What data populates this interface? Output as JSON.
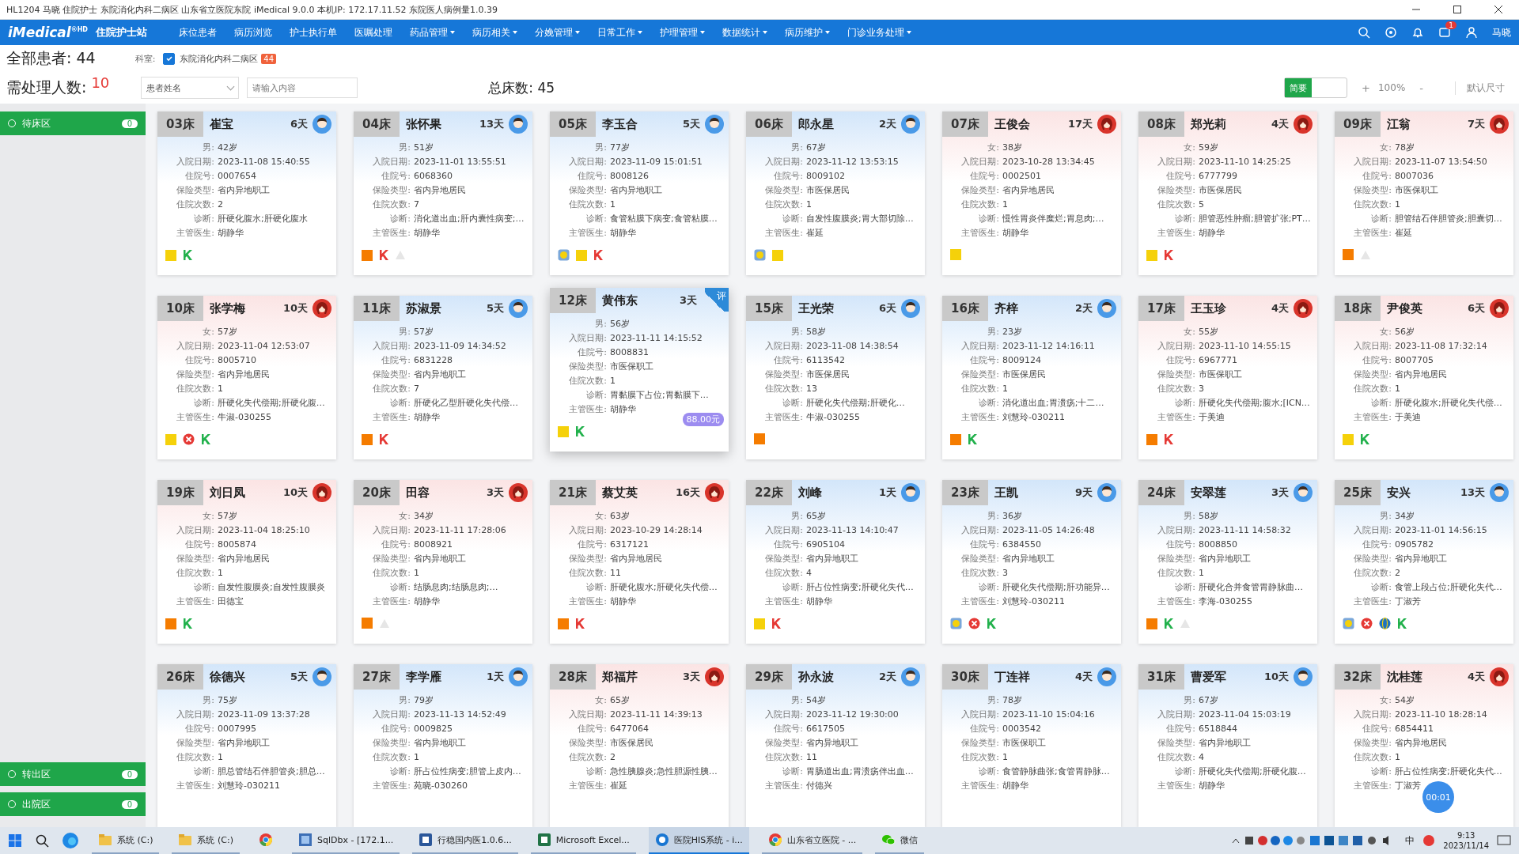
{
  "window": {
    "title": "HL1204 马晓 住院护士 东院消化内科二病区 山东省立医院东院 iMedical 9.0.0 本机IP: 172.17.11.52 东院医人病例量1.0.39"
  },
  "nav": {
    "logo": "iMedical",
    "logo_sup": "®HD",
    "module": "住院护士站",
    "items": [
      {
        "label": "床位患者",
        "dropdown": false
      },
      {
        "label": "病历浏览",
        "dropdown": false
      },
      {
        "label": "护士执行单",
        "dropdown": false
      },
      {
        "label": "医嘱处理",
        "dropdown": false
      },
      {
        "label": "药品管理",
        "dropdown": true
      },
      {
        "label": "病历相关",
        "dropdown": true
      },
      {
        "label": "分娩管理",
        "dropdown": true
      },
      {
        "label": "日常工作",
        "dropdown": true
      },
      {
        "label": "护理管理",
        "dropdown": true
      },
      {
        "label": "数据统计",
        "dropdown": true
      },
      {
        "label": "病历维护",
        "dropdown": true
      },
      {
        "label": "门诊业务处理",
        "dropdown": true
      }
    ],
    "message_badge": "1",
    "user": "马晓"
  },
  "summary": {
    "all_label": "全部患者: 44",
    "dept_label": "科室:",
    "dept_checked": true,
    "dept_name": "东院消化内科二病区",
    "dept_count": "44",
    "pending_label": "需处理人数:",
    "pending_count": "10",
    "name_select": "患者姓名",
    "search_placeholder": "请输入内容",
    "total_beds": "总床数: 45",
    "brief_label": "简要",
    "brief_on": true,
    "zoom_plus": "+",
    "zoom": "100%",
    "zoom_minus": "-",
    "default_size": "默认尺寸"
  },
  "sidebar": {
    "top": [
      {
        "label": "待床区",
        "count": "0"
      }
    ],
    "bottom": [
      {
        "label": "转出区",
        "count": "0"
      },
      {
        "label": "出院区",
        "count": "0"
      }
    ]
  },
  "cards": [
    {
      "bed": "03床",
      "name": "崔宝",
      "days": "6天",
      "kind": "male",
      "fields": [
        [
          "男:",
          "42岁"
        ],
        [
          "入院日期:",
          "2023-11-08 15:40:55"
        ],
        [
          "住院号:",
          "0007654"
        ],
        [
          "保险类型:",
          "省内异地职工"
        ],
        [
          "住院次数:",
          "2"
        ],
        [
          "诊断:",
          "肝硬化腹水;肝硬化腹水"
        ],
        [
          "主管医生:",
          "胡静华"
        ]
      ],
      "icons": [
        {
          "kind": "square",
          "color": "#f5d10a"
        },
        {
          "kind": "flag",
          "color": "#22b14c"
        }
      ]
    },
    {
      "bed": "04床",
      "name": "张怀果",
      "days": "13天",
      "kind": "male",
      "fields": [
        [
          "男:",
          "51岁"
        ],
        [
          "入院日期:",
          "2023-11-01 13:55:51"
        ],
        [
          "住院号:",
          "6068360"
        ],
        [
          "保险类型:",
          "省内异地居民"
        ],
        [
          "住院次数:",
          "7"
        ],
        [
          "诊断:",
          "消化道出血;肝内囊性病变;…"
        ],
        [
          "主管医生:",
          "胡静华"
        ]
      ],
      "icons": [
        {
          "kind": "square",
          "color": "#f57c00"
        },
        {
          "kind": "flag",
          "color": "#e53935"
        },
        {
          "kind": "triangle",
          "color": "#e6e6e6"
        }
      ]
    },
    {
      "bed": "05床",
      "name": "李玉合",
      "days": "5天",
      "kind": "male",
      "fields": [
        [
          "男:",
          "77岁"
        ],
        [
          "入院日期:",
          "2023-11-09 15:01:51"
        ],
        [
          "住院号:",
          "8008126"
        ],
        [
          "保险类型:",
          "省内异地职工"
        ],
        [
          "住院次数:",
          "1"
        ],
        [
          "诊断:",
          "食管粘膜下病变;食管粘膜…"
        ],
        [
          "主管医生:",
          "胡静华"
        ]
      ],
      "icons": [
        {
          "kind": "face",
          "color": "#7aa7d9"
        },
        {
          "kind": "square",
          "color": "#f5d10a"
        },
        {
          "kind": "flag",
          "color": "#e53935"
        }
      ]
    },
    {
      "bed": "06床",
      "name": "郎永星",
      "days": "2天",
      "kind": "male",
      "fields": [
        [
          "男:",
          "67岁"
        ],
        [
          "入院日期:",
          "2023-11-12 13:53:15"
        ],
        [
          "住院号:",
          "8009102"
        ],
        [
          "保险类型:",
          "市医保居民"
        ],
        [
          "住院次数:",
          "1"
        ],
        [
          "诊断:",
          "自发性腹膜炎;胃大部切除…"
        ],
        [
          "主管医生:",
          "崔延"
        ]
      ],
      "icons": [
        {
          "kind": "face",
          "color": "#7aa7d9"
        },
        {
          "kind": "square",
          "color": "#f5d10a"
        }
      ]
    },
    {
      "bed": "07床",
      "name": "王俊会",
      "days": "17天",
      "kind": "female",
      "fields": [
        [
          "女:",
          "38岁"
        ],
        [
          "入院日期:",
          "2023-10-28 13:34:45"
        ],
        [
          "住院号:",
          "0002501"
        ],
        [
          "保险类型:",
          "省内异地居民"
        ],
        [
          "住院次数:",
          "1"
        ],
        [
          "诊断:",
          "慢性胃炎伴糜烂;胃息肉;…"
        ],
        [
          "主管医生:",
          "胡静华"
        ]
      ],
      "icons": [
        {
          "kind": "square",
          "color": "#f5d10a"
        }
      ]
    },
    {
      "bed": "08床",
      "name": "郑光莉",
      "days": "4天",
      "kind": "female",
      "fields": [
        [
          "女:",
          "59岁"
        ],
        [
          "入院日期:",
          "2023-11-10 14:25:25"
        ],
        [
          "住院号:",
          "6777799"
        ],
        [
          "保险类型:",
          "市医保居民"
        ],
        [
          "住院次数:",
          "5"
        ],
        [
          "诊断:",
          "胆管恶性肿瘤;胆管扩张;PT…"
        ],
        [
          "主管医生:",
          "胡静华"
        ]
      ],
      "icons": [
        {
          "kind": "square",
          "color": "#f5d10a"
        },
        {
          "kind": "flag",
          "color": "#e53935"
        }
      ]
    },
    {
      "bed": "09床",
      "name": "江翁",
      "days": "7天",
      "kind": "female",
      "fields": [
        [
          "女:",
          "78岁"
        ],
        [
          "入院日期:",
          "2023-11-07 13:54:50"
        ],
        [
          "住院号:",
          "8007036"
        ],
        [
          "保险类型:",
          "市医保职工"
        ],
        [
          "住院次数:",
          "1"
        ],
        [
          "诊断:",
          "胆管结石伴胆管炎;胆囊切…"
        ],
        [
          "主管医生:",
          "崔延"
        ]
      ],
      "icons": [
        {
          "kind": "square",
          "color": "#f57c00"
        },
        {
          "kind": "triangle",
          "color": "#e6e6e6"
        }
      ]
    },
    {
      "bed": "10床",
      "name": "张学梅",
      "days": "10天",
      "kind": "female",
      "fields": [
        [
          "女:",
          "57岁"
        ],
        [
          "入院日期:",
          "2023-11-04 12:53:07"
        ],
        [
          "住院号:",
          "8005710"
        ],
        [
          "保险类型:",
          "省内异地居民"
        ],
        [
          "住院次数:",
          "1"
        ],
        [
          "诊断:",
          "肝硬化失代偿期;肝硬化腹…"
        ],
        [
          "主管医生:",
          "牛淑-030255"
        ]
      ],
      "icons": [
        {
          "kind": "square",
          "color": "#f5d10a"
        },
        {
          "kind": "cross",
          "color": "#e53935"
        },
        {
          "kind": "flag",
          "color": "#22b14c"
        }
      ]
    },
    {
      "bed": "11床",
      "name": "苏淑景",
      "days": "5天",
      "kind": "male",
      "fields": [
        [
          "男:",
          "57岁"
        ],
        [
          "入院日期:",
          "2023-11-09 14:34:52"
        ],
        [
          "住院号:",
          "6831228"
        ],
        [
          "保险类型:",
          "省内异地职工"
        ],
        [
          "住院次数:",
          "7"
        ],
        [
          "诊断:",
          "肝硬化乙型肝硬化失代偿…"
        ],
        [
          "主管医生:",
          "胡静华"
        ]
      ],
      "icons": [
        {
          "kind": "square",
          "color": "#f57c00"
        },
        {
          "kind": "flag",
          "color": "#e53935"
        }
      ]
    },
    {
      "bed": "12床",
      "name": "黄伟东",
      "days": "3天",
      "kind": "male",
      "corner_tag": "评",
      "fee": "88.00元",
      "fields": [
        [
          "男:",
          "56岁"
        ],
        [
          "入院日期:",
          "2023-11-11 14:15:52"
        ],
        [
          "住院号:",
          "8008831"
        ],
        [
          "保险类型:",
          "市医保职工"
        ],
        [
          "住院次数:",
          "1"
        ],
        [
          "诊断:",
          "胃黏膜下占位;胃黏膜下…"
        ],
        [
          "主管医生:",
          "胡静华"
        ]
      ],
      "icons": [
        {
          "kind": "square",
          "color": "#f5d10a"
        },
        {
          "kind": "flag",
          "color": "#22b14c"
        }
      ]
    },
    {
      "bed": "15床",
      "name": "王光荣",
      "days": "6天",
      "kind": "male",
      "fields": [
        [
          "男:",
          "58岁"
        ],
        [
          "入院日期:",
          "2023-11-08 14:38:54"
        ],
        [
          "住院号:",
          "6113542"
        ],
        [
          "保险类型:",
          "市医保居民"
        ],
        [
          "住院次数:",
          "13"
        ],
        [
          "诊断:",
          "肝硬化失代偿期;肝硬化…"
        ],
        [
          "主管医生:",
          "牛淑-030255"
        ]
      ],
      "icons": [
        {
          "kind": "square",
          "color": "#f57c00"
        }
      ]
    },
    {
      "bed": "16床",
      "name": "齐梓",
      "days": "2天",
      "kind": "male",
      "fields": [
        [
          "男:",
          "23岁"
        ],
        [
          "入院日期:",
          "2023-11-12 14:16:11"
        ],
        [
          "住院号:",
          "8009124"
        ],
        [
          "保险类型:",
          "市医保居民"
        ],
        [
          "住院次数:",
          "1"
        ],
        [
          "诊断:",
          "消化道出血;胃溃疡;十二…"
        ],
        [
          "主管医生:",
          "刘慧玲-030211"
        ]
      ],
      "icons": [
        {
          "kind": "square",
          "color": "#f57c00"
        },
        {
          "kind": "flag",
          "color": "#22b14c"
        }
      ]
    },
    {
      "bed": "17床",
      "name": "王玉珍",
      "days": "4天",
      "kind": "female",
      "fields": [
        [
          "女:",
          "55岁"
        ],
        [
          "入院日期:",
          "2023-11-10 14:55:15"
        ],
        [
          "住院号:",
          "6967771"
        ],
        [
          "保险类型:",
          "市医保职工"
        ],
        [
          "住院次数:",
          "3"
        ],
        [
          "诊断:",
          "肝硬化失代偿期;腹水;[ICN…"
        ],
        [
          "主管医生:",
          "于美迪"
        ]
      ],
      "icons": [
        {
          "kind": "square",
          "color": "#f57c00"
        },
        {
          "kind": "flag",
          "color": "#e53935"
        }
      ]
    },
    {
      "bed": "18床",
      "name": "尹俊英",
      "days": "6天",
      "kind": "female",
      "fields": [
        [
          "女:",
          "56岁"
        ],
        [
          "入院日期:",
          "2023-11-08 17:32:14"
        ],
        [
          "住院号:",
          "8007705"
        ],
        [
          "保险类型:",
          "省内异地居民"
        ],
        [
          "住院次数:",
          "1"
        ],
        [
          "诊断:",
          "肝硬化腹水;肝硬化失代偿…"
        ],
        [
          "主管医生:",
          "于美迪"
        ]
      ],
      "icons": [
        {
          "kind": "square",
          "color": "#f5d10a"
        },
        {
          "kind": "flag",
          "color": "#22b14c"
        }
      ]
    },
    {
      "bed": "19床",
      "name": "刘日凤",
      "days": "10天",
      "kind": "female",
      "fields": [
        [
          "女:",
          "57岁"
        ],
        [
          "入院日期:",
          "2023-11-04 18:25:10"
        ],
        [
          "住院号:",
          "8005874"
        ],
        [
          "保险类型:",
          "省内异地居民"
        ],
        [
          "住院次数:",
          "1"
        ],
        [
          "诊断:",
          "自发性腹膜炎;自发性腹膜炎"
        ],
        [
          "主管医生:",
          "田德宝"
        ]
      ],
      "icons": [
        {
          "kind": "square",
          "color": "#f57c00"
        },
        {
          "kind": "flag",
          "color": "#22b14c"
        }
      ]
    },
    {
      "bed": "20床",
      "name": "田容",
      "days": "3天",
      "kind": "female",
      "fields": [
        [
          "女:",
          "34岁"
        ],
        [
          "入院日期:",
          "2023-11-11 17:28:06"
        ],
        [
          "住院号:",
          "8008921"
        ],
        [
          "保险类型:",
          "省内异地职工"
        ],
        [
          "住院次数:",
          "1"
        ],
        [
          "诊断:",
          "结肠息肉;结肠息肉;…"
        ],
        [
          "主管医生:",
          "胡静华"
        ]
      ],
      "icons": [
        {
          "kind": "square",
          "color": "#f57c00"
        },
        {
          "kind": "triangle",
          "color": "#e6e6e6"
        }
      ]
    },
    {
      "bed": "21床",
      "name": "蔡艾英",
      "days": "16天",
      "kind": "female",
      "fields": [
        [
          "女:",
          "63岁"
        ],
        [
          "入院日期:",
          "2023-10-29 14:28:14"
        ],
        [
          "住院号:",
          "6317121"
        ],
        [
          "保险类型:",
          "省内异地居民"
        ],
        [
          "住院次数:",
          "11"
        ],
        [
          "诊断:",
          "肝硬化腹水;肝硬化失代偿…"
        ],
        [
          "主管医生:",
          "胡静华"
        ]
      ],
      "icons": [
        {
          "kind": "square",
          "color": "#f57c00"
        },
        {
          "kind": "flag",
          "color": "#e53935"
        }
      ]
    },
    {
      "bed": "22床",
      "name": "刘峰",
      "days": "1天",
      "kind": "male",
      "fields": [
        [
          "男:",
          "65岁"
        ],
        [
          "入院日期:",
          "2023-11-13 14:10:47"
        ],
        [
          "住院号:",
          "6905104"
        ],
        [
          "保险类型:",
          "省内异地职工"
        ],
        [
          "住院次数:",
          "4"
        ],
        [
          "诊断:",
          "肝占位性病变;肝硬化失代…"
        ],
        [
          "主管医生:",
          "胡静华"
        ]
      ],
      "icons": [
        {
          "kind": "square",
          "color": "#f5d10a"
        },
        {
          "kind": "flag",
          "color": "#e53935"
        }
      ]
    },
    {
      "bed": "23床",
      "name": "王凯",
      "days": "9天",
      "kind": "male",
      "fields": [
        [
          "男:",
          "36岁"
        ],
        [
          "入院日期:",
          "2023-11-05 14:26:48"
        ],
        [
          "住院号:",
          "6384550"
        ],
        [
          "保险类型:",
          "省内异地职工"
        ],
        [
          "住院次数:",
          "3"
        ],
        [
          "诊断:",
          "肝硬化失代偿期;肝功能异…"
        ],
        [
          "主管医生:",
          "刘慧玲-030211"
        ]
      ],
      "icons": [
        {
          "kind": "face",
          "color": "#7aa7d9"
        },
        {
          "kind": "cross",
          "color": "#e53935"
        },
        {
          "kind": "flag",
          "color": "#22b14c"
        }
      ]
    },
    {
      "bed": "24床",
      "name": "安翠莲",
      "days": "3天",
      "kind": "male",
      "fields": [
        [
          "男:",
          "58岁"
        ],
        [
          "入院日期:",
          "2023-11-11 14:58:32"
        ],
        [
          "住院号:",
          "8008850"
        ],
        [
          "保险类型:",
          "省内异地职工"
        ],
        [
          "住院次数:",
          "1"
        ],
        [
          "诊断:",
          "肝硬化合并食管胃静脉曲…"
        ],
        [
          "主管医生:",
          "李海-030255"
        ]
      ],
      "icons": [
        {
          "kind": "square",
          "color": "#f57c00"
        },
        {
          "kind": "flag",
          "color": "#22b14c"
        },
        {
          "kind": "triangle",
          "color": "#e6e6e6"
        }
      ]
    },
    {
      "bed": "25床",
      "name": "安兴",
      "days": "13天",
      "kind": "male",
      "fields": [
        [
          "男:",
          "34岁"
        ],
        [
          "入院日期:",
          "2023-11-01 14:56:15"
        ],
        [
          "住院号:",
          "0905782"
        ],
        [
          "保险类型:",
          "省内异地职工"
        ],
        [
          "住院次数:",
          "2"
        ],
        [
          "诊断:",
          "食管上段占位;肝硬化失代…"
        ],
        [
          "主管医生:",
          "丁淑芳"
        ]
      ],
      "icons": [
        {
          "kind": "face",
          "color": "#7aa7d9"
        },
        {
          "kind": "cross",
          "color": "#e53935"
        },
        {
          "kind": "globe",
          "color": "#1e73be"
        },
        {
          "kind": "flag",
          "color": "#22b14c"
        }
      ]
    },
    {
      "bed": "26床",
      "name": "徐德兴",
      "days": "5天",
      "kind": "male",
      "fields": [
        [
          "男:",
          "75岁"
        ],
        [
          "入院日期:",
          "2023-11-09 13:37:28"
        ],
        [
          "住院号:",
          "0007995"
        ],
        [
          "保险类型:",
          "省内异地职工"
        ],
        [
          "住院次数:",
          "1"
        ],
        [
          "诊断:",
          "胆总管结石伴胆管炎;胆总…"
        ],
        [
          "主管医生:",
          "刘慧玲-030211"
        ]
      ]
    },
    {
      "bed": "27床",
      "name": "李学雁",
      "days": "1天",
      "kind": "male",
      "fields": [
        [
          "男:",
          "79岁"
        ],
        [
          "入院日期:",
          "2023-11-13 14:52:49"
        ],
        [
          "住院号:",
          "0009825"
        ],
        [
          "保险类型:",
          "省内异地职工"
        ],
        [
          "住院次数:",
          "1"
        ],
        [
          "诊断:",
          "肝占位性病变;胆管上皮内…"
        ],
        [
          "主管医生:",
          "苑晓-030260"
        ]
      ]
    },
    {
      "bed": "28床",
      "name": "郑福芹",
      "days": "3天",
      "kind": "female",
      "fields": [
        [
          "女:",
          "65岁"
        ],
        [
          "入院日期:",
          "2023-11-11 14:39:13"
        ],
        [
          "住院号:",
          "6477064"
        ],
        [
          "保险类型:",
          "市医保居民"
        ],
        [
          "住院次数:",
          "2"
        ],
        [
          "诊断:",
          "急性胰腺炎;急性胆源性胰…"
        ],
        [
          "主管医生:",
          "崔延"
        ]
      ]
    },
    {
      "bed": "29床",
      "name": "孙永波",
      "days": "2天",
      "kind": "male",
      "fields": [
        [
          "男:",
          "54岁"
        ],
        [
          "入院日期:",
          "2023-11-12 19:30:00"
        ],
        [
          "住院号:",
          "6617505"
        ],
        [
          "保险类型:",
          "省内异地职工"
        ],
        [
          "住院次数:",
          "11"
        ],
        [
          "诊断:",
          "胃肠道出血;胃溃疡伴出血…"
        ],
        [
          "主管医生:",
          "付德兴"
        ]
      ]
    },
    {
      "bed": "30床",
      "name": "丁连祥",
      "days": "4天",
      "kind": "male",
      "fields": [
        [
          "男:",
          "78岁"
        ],
        [
          "入院日期:",
          "2023-11-10 15:04:16"
        ],
        [
          "住院号:",
          "0003542"
        ],
        [
          "保险类型:",
          "市医保职工"
        ],
        [
          "住院次数:",
          "1"
        ],
        [
          "诊断:",
          "食管静脉曲张;食管胃静脉…"
        ],
        [
          "主管医生:",
          "胡静华"
        ]
      ]
    },
    {
      "bed": "31床",
      "name": "曹爱军",
      "days": "10天",
      "kind": "male",
      "fields": [
        [
          "男:",
          "67岁"
        ],
        [
          "入院日期:",
          "2023-11-04 15:03:19"
        ],
        [
          "住院号:",
          "6518844"
        ],
        [
          "保险类型:",
          "省内异地职工"
        ],
        [
          "住院次数:",
          "4"
        ],
        [
          "诊断:",
          "肝硬化失代偿期;肝硬化腹…"
        ],
        [
          "主管医生:",
          "胡静华"
        ]
      ]
    },
    {
      "bed": "32床",
      "name": "沈桂莲",
      "days": "4天",
      "kind": "female",
      "fields": [
        [
          "女:",
          "54岁"
        ],
        [
          "入院日期:",
          "2023-11-10 18:28:14"
        ],
        [
          "住院号:",
          "6854411"
        ],
        [
          "保险类型:",
          "省内异地居民"
        ],
        [
          "住院次数:",
          "1"
        ],
        [
          "诊断:",
          "肝占位性病变;肝硬化失代…"
        ],
        [
          "主管医生:",
          "丁淑芳"
        ]
      ]
    }
  ],
  "floating_timer": "00:01",
  "taskbar": {
    "apps": [
      {
        "label": "系统 (C:)",
        "kind": "folder",
        "active": false
      },
      {
        "label": "系统 (C:)",
        "kind": "folder",
        "active": false
      },
      {
        "kind": "chrome",
        "active": false
      },
      {
        "label": "SqlDbx - [172.1...",
        "kind": "db",
        "active": false
      },
      {
        "label": "行稳国内医1.0.6...",
        "kind": "word",
        "active": false
      },
      {
        "label": "Microsoft Excel...",
        "kind": "excel",
        "active": false
      },
      {
        "label": "医院HIS系统 - i...",
        "kind": "his",
        "active": true
      },
      {
        "label": "山东省立医院 - ...",
        "kind": "chrome",
        "active": false
      },
      {
        "label": "微信",
        "kind": "wechat",
        "active": false
      }
    ],
    "ime": "中",
    "time": "9:13",
    "date": "2023/11/14"
  }
}
